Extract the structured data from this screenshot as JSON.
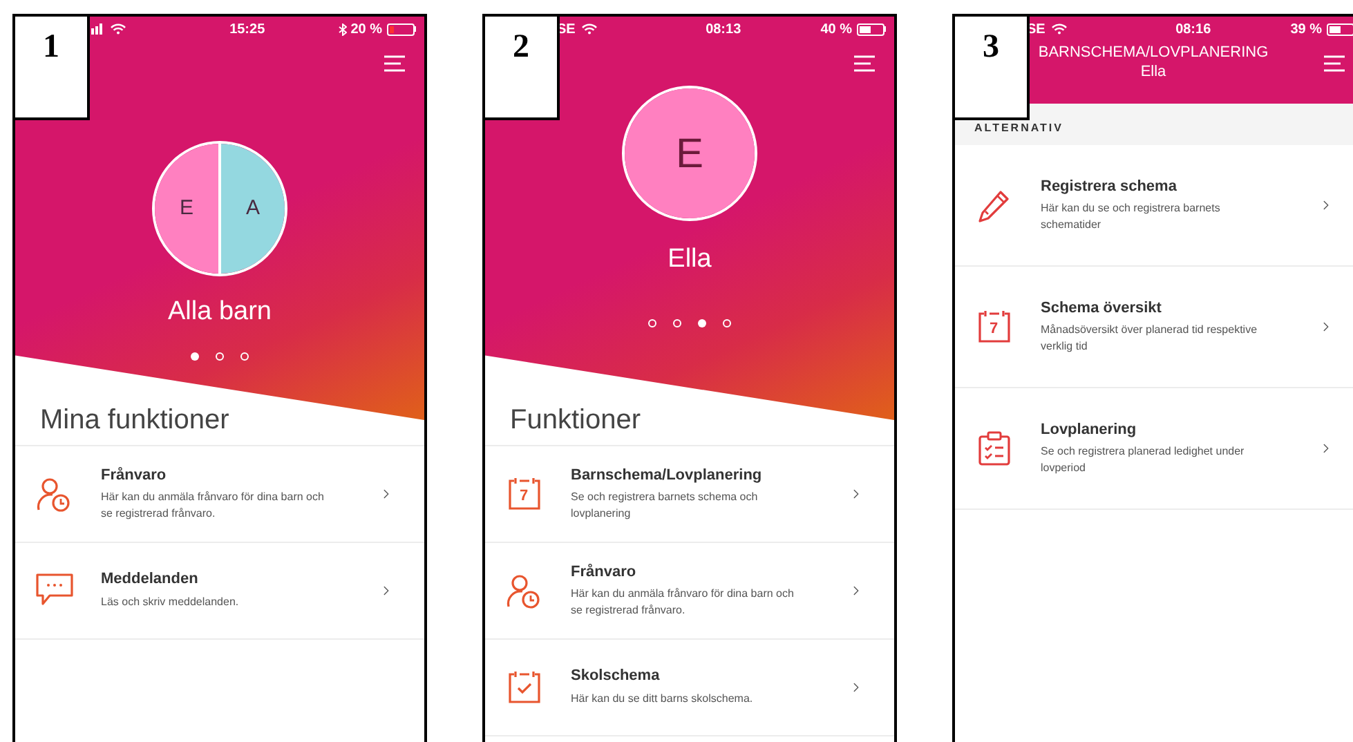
{
  "screens": [
    {
      "label": "1",
      "kind": "home",
      "status_bar": {
        "time": "15:25",
        "battery": "20 %",
        "bluetooth": true,
        "battery_low": true
      },
      "avatar": {
        "initials": [
          {
            "text": "E",
            "color": "#ff80c0"
          },
          {
            "text": "A",
            "color": "#94d8e0"
          }
        ]
      },
      "name": "Alla barn",
      "pages": [
        {
          "selected": true
        },
        {
          "selected": false
        },
        {
          "selected": false
        }
      ],
      "section_title": "Mina funktioner",
      "items": [
        {
          "kind": "person-clock",
          "title": "Frånvaro",
          "description": "Här kan du anmäla frånvaro för dina barn och se registrerad frånvaro."
        },
        {
          "kind": "chat",
          "title": "Meddelanden",
          "description": "Läs och skriv meddelanden."
        }
      ]
    },
    {
      "label": "2",
      "kind": "home",
      "status_bar": {
        "carrier": "SE",
        "time": "08:13",
        "battery": "40 %",
        "bluetooth": false,
        "battery_low": false
      },
      "avatar": {
        "initials": [
          {
            "text": "E",
            "color": "#ff80c0"
          }
        ]
      },
      "name": "Ella",
      "pages": [
        {
          "selected": false
        },
        {
          "selected": false
        },
        {
          "selected": true
        },
        {
          "selected": false
        }
      ],
      "section_title": "Funktioner",
      "items": [
        {
          "kind": "calendar",
          "icon_text": "7",
          "title": "Barnschema/Lovplanering",
          "description": "Se och registrera barnets schema och lovplanering"
        },
        {
          "kind": "person-clock",
          "title": "Frånvaro",
          "description": "Här kan du anmäla frånvaro för dina barn och se registrerad frånvaro."
        },
        {
          "kind": "calendar-check",
          "title": "Skolschema",
          "description": "Här kan du se ditt barns skolschema."
        }
      ]
    },
    {
      "label": "3",
      "kind": "detail",
      "status_bar": {
        "carrier": "SE",
        "time": "08:16",
        "battery": "39 %",
        "bluetooth": false,
        "battery_low": false
      },
      "header": {
        "title": "BARNSCHEMA/LOVPLANERING",
        "subtitle": "Ella"
      },
      "section_title": "ALTERNATIV",
      "items": [
        {
          "kind": "pencil",
          "title": "Registrera schema",
          "description": "Här kan du se och registrera barnets schematider"
        },
        {
          "kind": "calendar",
          "icon_text": "7",
          "title": "Schema översikt",
          "description": "Månadsöversikt över planerad tid respektive verklig tid"
        },
        {
          "kind": "clipboard",
          "title": "Lovplanering",
          "description": "Se och registrera planerad ledighet under lovperiod"
        }
      ]
    }
  ]
}
